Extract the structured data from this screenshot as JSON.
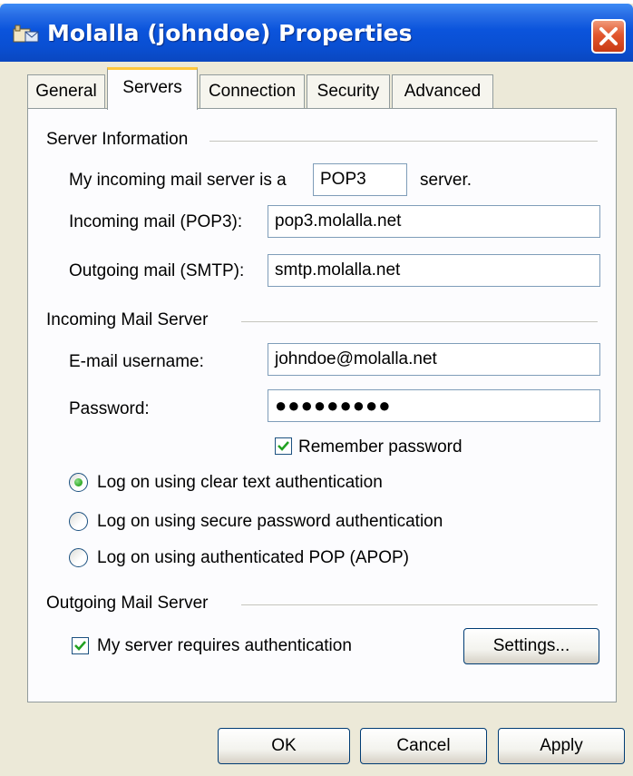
{
  "window": {
    "title": "Molalla (johndoe) Properties",
    "icons": {
      "title": "mail-account-icon",
      "close": "close-icon"
    }
  },
  "tabs": [
    {
      "label": "General",
      "active": false
    },
    {
      "label": "Servers",
      "active": true
    },
    {
      "label": "Connection",
      "active": false
    },
    {
      "label": "Security",
      "active": false
    },
    {
      "label": "Advanced",
      "active": false
    }
  ],
  "server_information": {
    "heading": "Server Information",
    "type_prefix": "My incoming mail server is a",
    "type_value": "POP3",
    "type_suffix": "server.",
    "incoming_label": "Incoming mail (POP3):",
    "incoming_value": "pop3.molalla.net",
    "outgoing_label": "Outgoing mail (SMTP):",
    "outgoing_value": "smtp.molalla.net"
  },
  "incoming_mail_server": {
    "heading": "Incoming Mail Server",
    "username_label": "E-mail username:",
    "username_value": "johndoe@molalla.net",
    "password_label": "Password:",
    "password_value": "●●●●●●●●●",
    "remember_label": "Remember password",
    "remember_checked": true,
    "auth_options": [
      {
        "label": "Log on using clear text authentication",
        "selected": true
      },
      {
        "label": "Log on using secure password authentication",
        "selected": false
      },
      {
        "label": "Log on using authenticated POP (APOP)",
        "selected": false
      }
    ]
  },
  "outgoing_mail_server": {
    "heading": "Outgoing Mail Server",
    "requires_auth_label": "My server requires authentication",
    "requires_auth_checked": true,
    "settings_button": "Settings..."
  },
  "buttons": {
    "ok": "OK",
    "cancel": "Cancel",
    "apply": "Apply"
  },
  "colors": {
    "titlebar": "#0a4fd2",
    "close": "#e2572f",
    "active_tab_accent": "#ffc73c",
    "dialog_bg": "#ece9d8"
  }
}
